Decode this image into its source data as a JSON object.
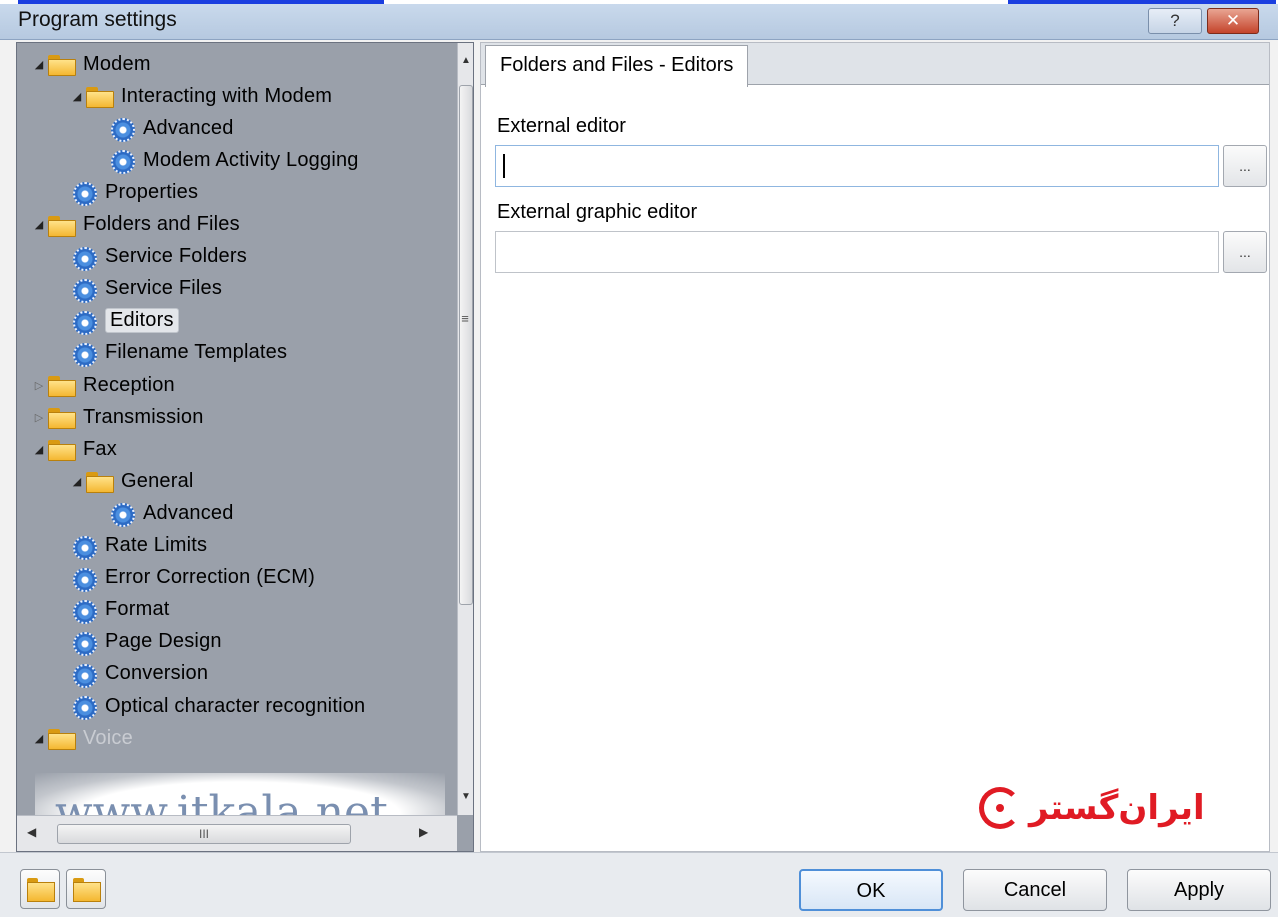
{
  "window": {
    "title": "Program settings",
    "help_glyph": "?",
    "close_glyph": "✕"
  },
  "tree": {
    "items": [
      {
        "label": "Modem",
        "type": "folder",
        "level": 0,
        "expander": "expanded"
      },
      {
        "label": "Interacting with Modem",
        "type": "folder",
        "level": 1,
        "expander": "expanded"
      },
      {
        "label": "Advanced",
        "type": "gear",
        "level": 2
      },
      {
        "label": "Modem Activity Logging",
        "type": "gear",
        "level": 2
      },
      {
        "label": "Properties",
        "type": "gear",
        "level": 1
      },
      {
        "label": "Folders and Files",
        "type": "folder",
        "level": 0,
        "expander": "expanded"
      },
      {
        "label": "Service Folders",
        "type": "gear",
        "level": 1
      },
      {
        "label": "Service Files",
        "type": "gear",
        "level": 1
      },
      {
        "label": "Editors",
        "type": "gear",
        "level": 1,
        "selected": true
      },
      {
        "label": "Filename Templates",
        "type": "gear",
        "level": 1
      },
      {
        "label": "Reception",
        "type": "folder",
        "level": 0,
        "expander": "collapsed"
      },
      {
        "label": "Transmission",
        "type": "folder",
        "level": 0,
        "expander": "collapsed"
      },
      {
        "label": "Fax",
        "type": "folder",
        "level": 0,
        "expander": "expanded"
      },
      {
        "label": "General",
        "type": "folder",
        "level": 1,
        "expander": "expanded"
      },
      {
        "label": "Advanced",
        "type": "gear",
        "level": 2
      },
      {
        "label": "Rate Limits",
        "type": "gear",
        "level": 1
      },
      {
        "label": "Error Correction (ECM)",
        "type": "gear",
        "level": 1
      },
      {
        "label": "Format",
        "type": "gear",
        "level": 1
      },
      {
        "label": "Page Design",
        "type": "gear",
        "level": 1
      },
      {
        "label": "Conversion",
        "type": "gear",
        "level": 1
      },
      {
        "label": "Optical character recognition",
        "type": "gear",
        "level": 1
      },
      {
        "label": "Voice",
        "type": "folder",
        "level": 0,
        "expander": "expanded",
        "faded": true
      }
    ],
    "vscroll_grip": "≡",
    "hscroll_grip": "III"
  },
  "watermark": "www.itkala.net",
  "content": {
    "tab_label": "Folders and Files - Editors",
    "external_editor_label": "External editor",
    "external_editor_value": "",
    "external_graphic_editor_label": "External graphic editor",
    "external_graphic_editor_value": "",
    "browse_label": "..."
  },
  "logo_text": "ایران‌گستر",
  "buttons": {
    "ok": "OK",
    "cancel": "Cancel",
    "apply": "Apply"
  },
  "colors": {
    "tree_background": "#9aa0aa",
    "link_bar": "#1a3ee0",
    "logo_red": "#e01b24",
    "default_button_border": "#4f8fd8"
  }
}
